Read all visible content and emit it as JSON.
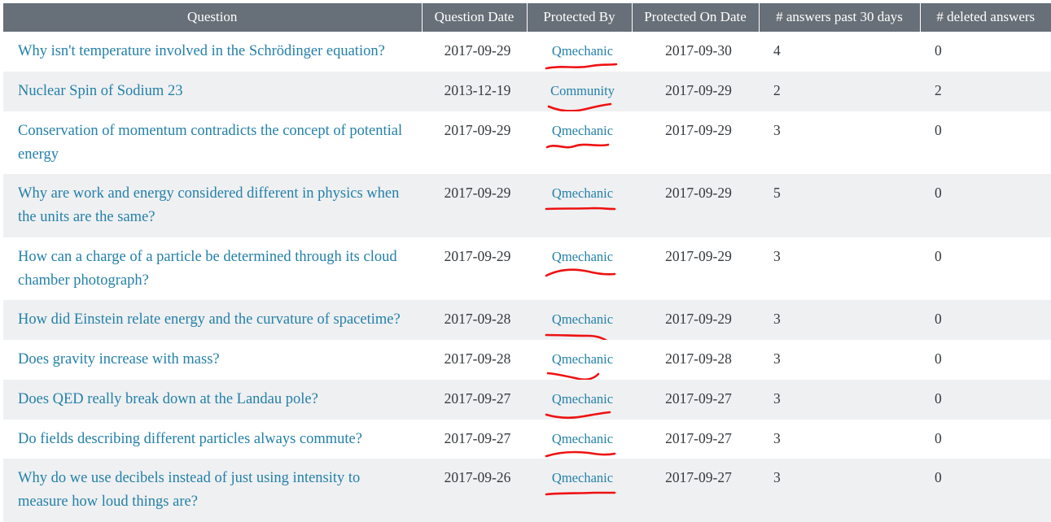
{
  "table": {
    "columns": [
      {
        "key": "question",
        "label": "Question"
      },
      {
        "key": "question_date",
        "label": "Question Date"
      },
      {
        "key": "protected_by",
        "label": "Protected By"
      },
      {
        "key": "protected_on",
        "label": "Protected On Date"
      },
      {
        "key": "answers_30",
        "label": "# answers past 30 days"
      },
      {
        "key": "deleted",
        "label": "# deleted answers"
      }
    ],
    "rows": [
      {
        "question": "Why isn't temperature involved in the Schrödinger equation?",
        "question_date": "2017-09-29",
        "protected_by": "Qmechanic",
        "protected_on": "2017-09-30",
        "answers_30": "4",
        "deleted": "0"
      },
      {
        "question": "Nuclear Spin of Sodium 23",
        "question_date": "2013-12-19",
        "protected_by": "Community",
        "protected_on": "2017-09-29",
        "answers_30": "2",
        "deleted": "2"
      },
      {
        "question": "Conservation of momentum contradicts the concept of potential energy",
        "question_date": "2017-09-29",
        "protected_by": "Qmechanic",
        "protected_on": "2017-09-29",
        "answers_30": "3",
        "deleted": "0"
      },
      {
        "question": "Why are work and energy considered different in physics when the units are the same?",
        "question_date": "2017-09-29",
        "protected_by": "Qmechanic",
        "protected_on": "2017-09-29",
        "answers_30": "5",
        "deleted": "0"
      },
      {
        "question": "How can a charge of a particle be determined through its cloud chamber photograph?",
        "question_date": "2017-09-29",
        "protected_by": "Qmechanic",
        "protected_on": "2017-09-29",
        "answers_30": "3",
        "deleted": "0"
      },
      {
        "question": "How did Einstein relate energy and the curvature of spacetime?",
        "question_date": "2017-09-28",
        "protected_by": "Qmechanic",
        "protected_on": "2017-09-29",
        "answers_30": "3",
        "deleted": "0"
      },
      {
        "question": "Does gravity increase with mass?",
        "question_date": "2017-09-28",
        "protected_by": "Qmechanic",
        "protected_on": "2017-09-28",
        "answers_30": "3",
        "deleted": "0"
      },
      {
        "question": "Does QED really break down at the Landau pole?",
        "question_date": "2017-09-27",
        "protected_by": "Qmechanic",
        "protected_on": "2017-09-27",
        "answers_30": "3",
        "deleted": "0"
      },
      {
        "question": "Do fields describing different particles always commute?",
        "question_date": "2017-09-27",
        "protected_by": "Qmechanic",
        "protected_on": "2017-09-27",
        "answers_30": "3",
        "deleted": "0"
      },
      {
        "question": "Why do we use decibels instead of just using intensity to measure how loud things are?",
        "question_date": "2017-09-26",
        "protected_by": "Qmechanic",
        "protected_on": "2017-09-27",
        "answers_30": "3",
        "deleted": "0"
      }
    ]
  },
  "annotations": {
    "marker_color": "#ee1111",
    "underlines": [
      {
        "row": 0,
        "target": "protected_by"
      },
      {
        "row": 1,
        "target": "protected_by"
      },
      {
        "row": 2,
        "target": "protected_by"
      },
      {
        "row": 3,
        "target": "protected_by"
      },
      {
        "row": 4,
        "target": "protected_by"
      },
      {
        "row": 5,
        "target": "protected_by"
      },
      {
        "row": 6,
        "target": "protected_by"
      },
      {
        "row": 7,
        "target": "protected_by"
      },
      {
        "row": 8,
        "target": "protected_by"
      },
      {
        "row": 9,
        "target": "protected_by"
      }
    ]
  },
  "theme": {
    "header_bg": "#676f78",
    "header_fg": "#ffffff",
    "row_odd_bg": "#ffffff",
    "row_even_bg": "#eff0f2",
    "link_color": "#2380a8",
    "text_color": "#34393d"
  }
}
